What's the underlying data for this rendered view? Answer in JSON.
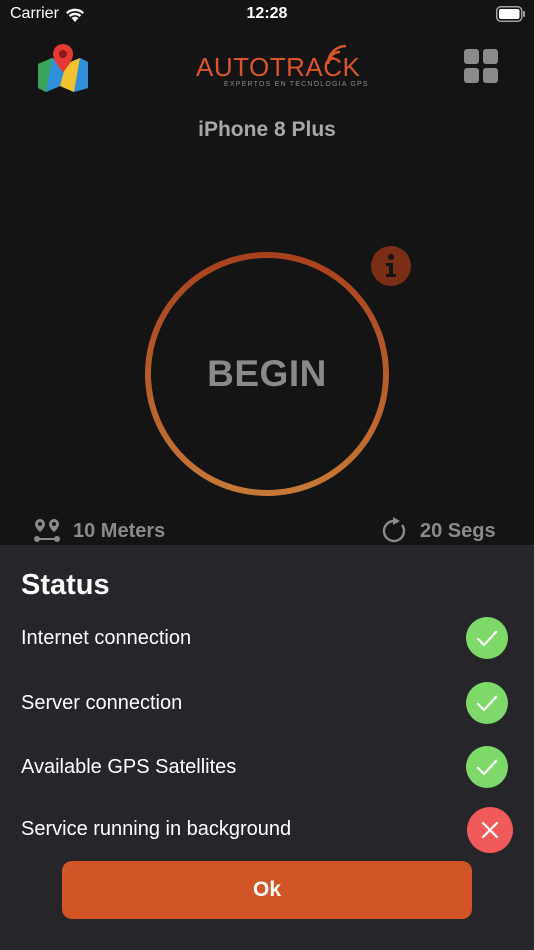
{
  "status_bar": {
    "carrier": "Carrier",
    "time": "12:28",
    "wifi_icon": "wifi-icon",
    "battery_icon": "battery-icon"
  },
  "header": {
    "map_icon": "map-pin-icon",
    "logo": {
      "auto": "AUTO",
      "track": "TRACK",
      "tagline": "EXPERTOS EN TECNOLOGIA GPS"
    },
    "menu_icon": "grid-icon"
  },
  "device_name": "iPhone 8 Plus",
  "begin": {
    "label": "BEGIN"
  },
  "readouts": {
    "distance": "10 Meters",
    "interval": "20 Segs"
  },
  "status_sheet": {
    "title": "Status",
    "items": [
      {
        "label": "Internet connection",
        "ok": true
      },
      {
        "label": "Server connection",
        "ok": true
      },
      {
        "label": "Available GPS Satellites",
        "ok": true
      },
      {
        "label": "Service running in background",
        "ok": false
      }
    ],
    "ok_button": "Ok"
  },
  "colors": {
    "accent": "#d15527",
    "ok": "#7ed96a",
    "fail": "#f05a5a",
    "sheet": "#26262a"
  }
}
